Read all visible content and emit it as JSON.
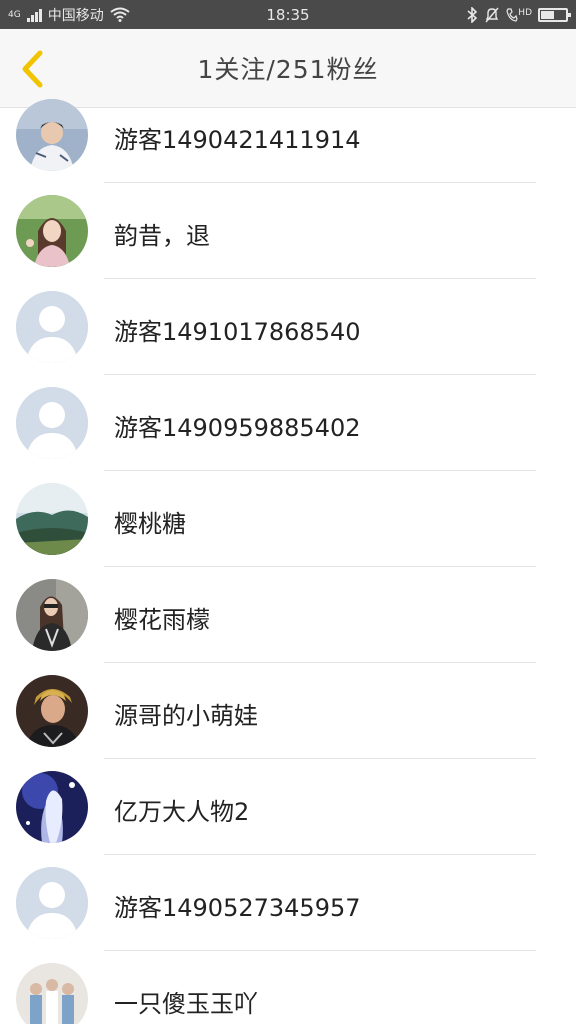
{
  "status_bar": {
    "carrier": "中国移动",
    "network": "4G",
    "time": "18:35",
    "hd_label": "HD"
  },
  "header": {
    "title": "1关注/251粉丝",
    "back_icon": "chevron-left-icon",
    "accent_color": "#f0c400"
  },
  "fans": [
    {
      "name": "游客1490421411914",
      "avatar": "photo-boy"
    },
    {
      "name": "韵昔，退",
      "avatar": "photo-girl"
    },
    {
      "name": "游客1491017868540",
      "avatar": "default"
    },
    {
      "name": "游客1490959885402",
      "avatar": "default"
    },
    {
      "name": "樱桃糖",
      "avatar": "landscape"
    },
    {
      "name": "樱花雨檬",
      "avatar": "photo-woman"
    },
    {
      "name": "源哥的小萌娃",
      "avatar": "photo-singer"
    },
    {
      "name": "亿万大人物2",
      "avatar": "anime"
    },
    {
      "name": "游客1490527345957",
      "avatar": "default"
    },
    {
      "name": "一只傻玉玉吖",
      "avatar": "group-photo"
    }
  ],
  "colors": {
    "status_bar_bg": "#4a4a4a",
    "header_bg": "#f7f7f7",
    "default_avatar_bg": "#d2dce8"
  }
}
